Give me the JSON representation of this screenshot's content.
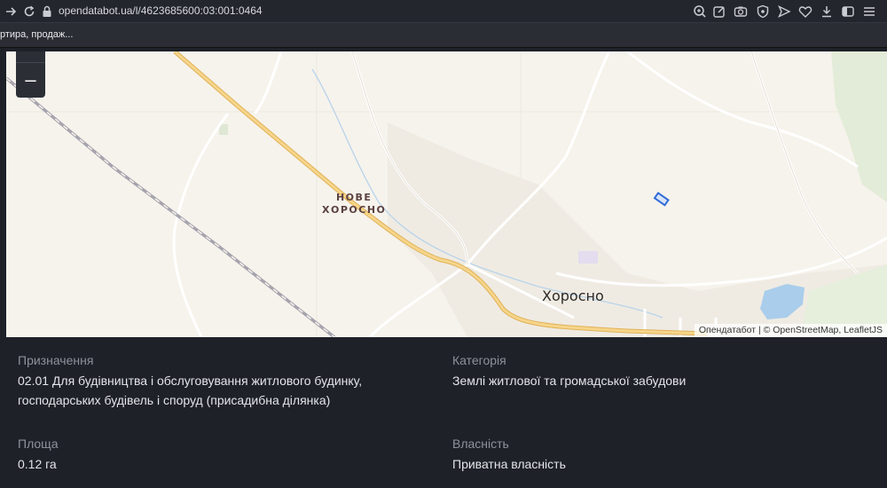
{
  "browser": {
    "url": "opendatabot.ua/l/4623685600:03:001:0464",
    "bookmark": "ртира, продаж..."
  },
  "map": {
    "zoom_out_label": "–",
    "places": {
      "nove_line1": "НОВЕ",
      "nove_line2": "ХОРОСНО",
      "khorosno": "Хоросно"
    },
    "attribution": "Опендатабот | © OpenStreetMap, LeafletJS"
  },
  "info": {
    "purpose_label": "Призначення",
    "purpose_line1": "02.01 Для будівництва і обслуговування житлового будинку,",
    "purpose_line2": "господарських будівель і споруд (присадибна ділянка)",
    "category_label": "Категорія",
    "category_value": "Землі житлової та громадської забудови",
    "area_label": "Площа",
    "area_value": "0.12 га",
    "ownership_label": "Власність",
    "ownership_value": "Приватна власність"
  },
  "colors": {
    "parcel": "#2f6bd8",
    "water": "#a9cdeb",
    "main_road": "#f2c96b",
    "railway": "#a5a3ad"
  }
}
